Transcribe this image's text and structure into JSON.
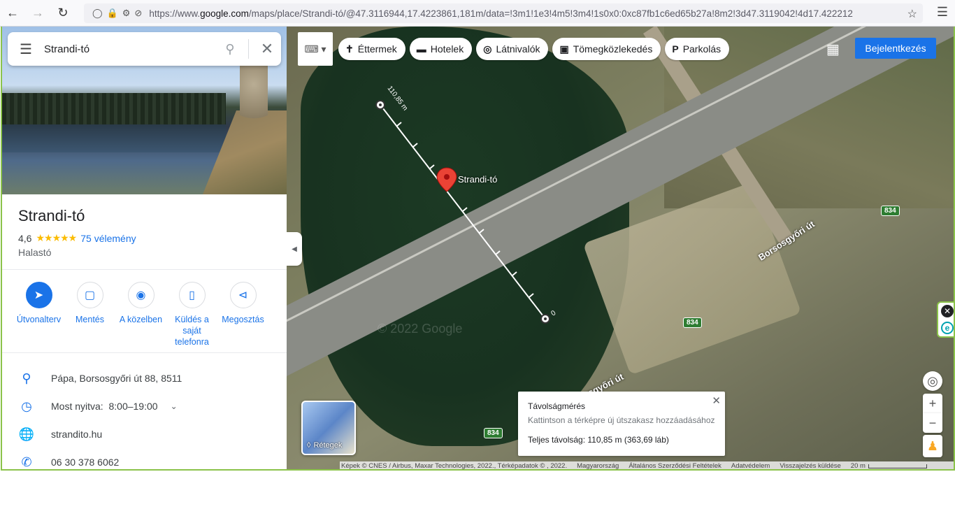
{
  "browser": {
    "url_prefix": "https://www.",
    "url_domain": "google.com",
    "url_suffix": "/maps/place/Strandi-tó/@47.3116944,17.4223861,181m/data=!3m1!1e3!4m5!3m4!1s0x0:0xc87fb1c6ed65b27a!8m2!3d47.3119042!4d17.422212"
  },
  "search": {
    "value": "Strandi-tó"
  },
  "place": {
    "title": "Strandi-tó",
    "rating": "4,6",
    "stars": "★★★★★",
    "reviews": "75 vélemény",
    "category": "Halastó"
  },
  "actions": [
    {
      "label": "Útvonalterv",
      "icon": "directions-icon"
    },
    {
      "label": "Mentés",
      "icon": "bookmark-icon"
    },
    {
      "label": "A közelben",
      "icon": "nearby-icon"
    },
    {
      "label": "Küldés a saját telefonra",
      "icon": "phone-send-icon"
    },
    {
      "label": "Megosztás",
      "icon": "share-icon"
    }
  ],
  "info": {
    "address": "Pápa, Borsosgyőri út 88, 8511",
    "hours_status": "Most nyitva:",
    "hours": "8:00–19:00",
    "website": "strandito.hu",
    "phone": "06 30 378 6062"
  },
  "map": {
    "chips": [
      {
        "label": "Éttermek",
        "icon": "fork-knife-icon"
      },
      {
        "label": "Hotelek",
        "icon": "bed-icon"
      },
      {
        "label": "Látnivalók",
        "icon": "camera-icon"
      },
      {
        "label": "Tömegközlekedés",
        "icon": "transit-icon"
      },
      {
        "label": "Parkolás",
        "icon": "parking-icon"
      }
    ],
    "signin": "Bejelentkezés",
    "marker_label": "Strandi-tó",
    "watermark": "© 2022 Google",
    "measure_line_label": "110,85 m",
    "measure_end_label": "0",
    "road_name": "Borsosgyőri út",
    "road_number": "834",
    "layers_label": "Rétegek",
    "measure": {
      "title": "Távolságmérés",
      "hint": "Kattintson a térképre új útszakasz hozzáadásához",
      "total": "Teljes távolság: 110,85 m (363,69 láb)"
    },
    "footer": {
      "imagery": "Képek © CNES / Airbus, Maxar Technologies, 2022., Térképadatok © , 2022.",
      "country": "Magyarország",
      "terms": "Általános Szerződési Feltételek",
      "privacy": "Adatvédelem",
      "feedback": "Visszajelzés küldése",
      "scale": "20 m"
    }
  },
  "colors": {
    "accent": "#1a73e8",
    "star": "#fbbc04",
    "marker": "#ea4335",
    "frame_border": "#8bc34a"
  }
}
